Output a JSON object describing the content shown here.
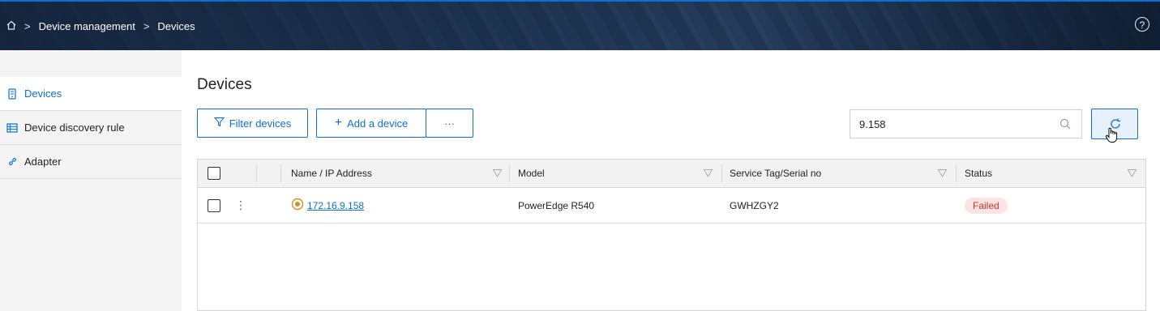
{
  "breadcrumb": {
    "home_icon": "home-icon",
    "items": [
      "Device management",
      "Devices"
    ],
    "separator": ">"
  },
  "header": {
    "help_icon": "help-icon",
    "help_glyph": "?"
  },
  "sidebar": {
    "items": [
      {
        "label": "Devices",
        "icon": "device-icon",
        "active": true
      },
      {
        "label": "Device discovery rule",
        "icon": "discovery-rule-icon",
        "active": false
      },
      {
        "label": "Adapter",
        "icon": "link-icon",
        "active": false
      }
    ]
  },
  "main": {
    "title": "Devices",
    "toolbar": {
      "filter_label": "Filter devices",
      "add_label": "Add a device",
      "add_glyph": "+",
      "more_glyph": "···"
    },
    "search": {
      "value": "9.158",
      "icon": "search-icon"
    },
    "refresh_icon": "refresh-icon"
  },
  "table": {
    "columns": [
      "Name / IP Address",
      "Model",
      "Service Tag/Serial no",
      "Status"
    ],
    "rows": [
      {
        "ip": "172.16.9.158",
        "model": "PowerEdge R540",
        "service_tag": "GWHZGY2",
        "status": "Failed",
        "menu_glyph": "⋮"
      }
    ]
  },
  "colors": {
    "accent": "#0b6fd6",
    "status_failed_bg": "#fde3e3",
    "status_failed_text": "#c0392b",
    "device_status_ring": "#d4901f"
  }
}
